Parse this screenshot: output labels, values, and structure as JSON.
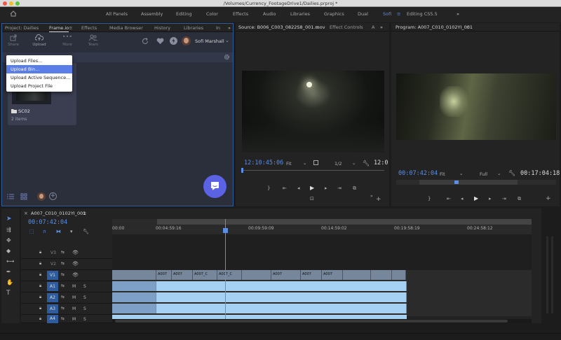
{
  "window": {
    "title": "/Volumes/Currency_FootageDrive1/Dailies.prproj *"
  },
  "workspaces": [
    "All Panels",
    "Assembly",
    "Editing",
    "Color",
    "Effects",
    "Audio",
    "Libraries",
    "Graphics",
    "Dual",
    "Sofi",
    "Editing CS5.5"
  ],
  "workspace_active": "Sofi",
  "left_panel": {
    "tabs": [
      "Project: Dailies",
      "Frame.io",
      "Effects",
      "Media Browser",
      "History",
      "Libraries",
      "In"
    ],
    "active_tab": "Frame.io",
    "tools": [
      "Share",
      "Upload",
      "More",
      "Team"
    ],
    "user_name": "Sofi Marshall",
    "upload_menu": [
      "Upload Files...",
      "Upload Bin...",
      "Upload Active Sequence...",
      "Upload Project File"
    ],
    "upload_menu_selected": "Upload Bin...",
    "folder": {
      "name": "SC02",
      "count": "2 items"
    }
  },
  "source": {
    "tab": "Source: B006_C003_0822S8_001.mov",
    "tab2": "Effect Controls",
    "timecode": "12:10:45:06",
    "zoom": "Fit",
    "resolution": "1/2",
    "end_timecode": "12:0"
  },
  "program": {
    "tab": "Program: A007_C010_0102YI_001",
    "timecode": "00:07:42:04",
    "zoom": "Fit",
    "quality": "Full",
    "end_timecode": "00:17:04:18"
  },
  "timeline": {
    "sequence_name": "A007_C010_0102YI_001",
    "timecode": "00:07:42:04",
    "ruler": [
      "00:00",
      "00:04:59:16",
      "00:09:59:09",
      "00:14:59:02",
      "00:19:58:19",
      "00:24:58:12"
    ],
    "video_tracks": [
      "V3",
      "V2",
      "V1"
    ],
    "audio_tracks": [
      "A1",
      "A2",
      "A3",
      "A4"
    ],
    "clip_labels": [
      "A007",
      "A007",
      "A007_C",
      "A007_C",
      "A007",
      "A007",
      "A007"
    ],
    "track_m": "M",
    "track_s": "S",
    "playhead_fraction": 0.27
  },
  "colors": {
    "accent": "#5b8ee6",
    "frameio_bg": "#2b2e3b",
    "clip_audio": "#a7d1f2",
    "clip_video": "#76869b",
    "menu_highlight": "#5b7de8",
    "fab": "#5b62e3"
  }
}
